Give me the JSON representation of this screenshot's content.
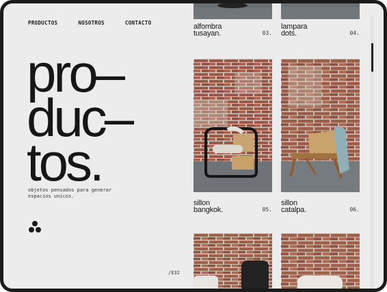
{
  "nav": {
    "items": [
      "PRODUCTOS",
      "NOSOTROS",
      "CONTACTO"
    ]
  },
  "hero": {
    "title_lines": [
      "pro–",
      "duc–",
      "tos."
    ],
    "subtitle": "objetos pensados para generar espacios unicos."
  },
  "footer": {
    "page_code": "/E32"
  },
  "products": [
    {
      "name_line1": "alfombra",
      "name_line2": "tusayan.",
      "number": "03."
    },
    {
      "name_line1": "lampara",
      "name_line2": "dots.",
      "number": "04."
    },
    {
      "name_line1": "sillon",
      "name_line2": "bangkok.",
      "number": "05."
    },
    {
      "name_line1": "sillon",
      "name_line2": "catalpa.",
      "number": "06."
    }
  ],
  "colors": {
    "background": "#ececec",
    "text": "#161616",
    "brick": "#9a5a48",
    "floor": "#6d7276"
  }
}
